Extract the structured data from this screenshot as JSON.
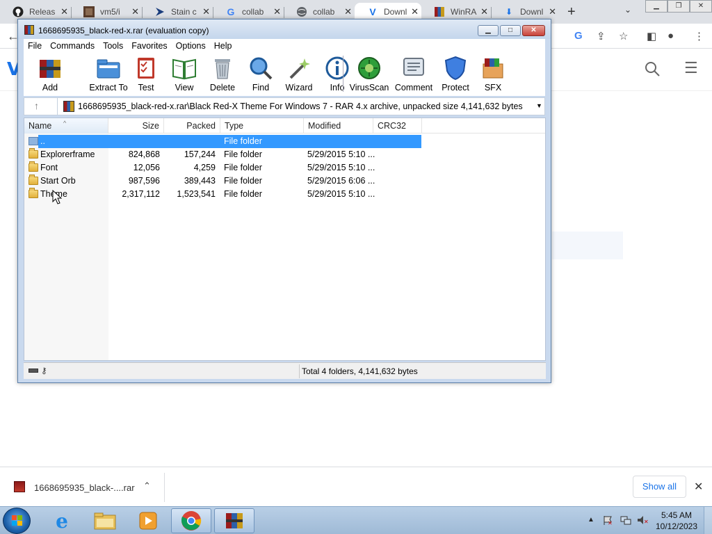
{
  "chrome": {
    "tabs": [
      {
        "title": "Releas",
        "icon": "github-icon"
      },
      {
        "title": "vm5/i",
        "icon": "image-icon"
      },
      {
        "title": "Stain c",
        "icon": "triangle-icon"
      },
      {
        "title": "collab",
        "icon": "google-icon"
      },
      {
        "title": "collab",
        "icon": "globe-icon"
      },
      {
        "title": "Downl",
        "icon": "vk-icon"
      },
      {
        "title": "WinRA",
        "icon": "winrar-icon"
      },
      {
        "title": "Downl",
        "icon": "download-icon"
      }
    ],
    "active_tab_index": 5
  },
  "downloads": {
    "file_name": "1668695935_black-....rar",
    "show_all_label": "Show all"
  },
  "taskbar": {
    "time": "5:45 AM",
    "date": "10/12/2023"
  },
  "winrar": {
    "title": "1668695935_black-red-x.rar (evaluation copy)",
    "menu": [
      "File",
      "Commands",
      "Tools",
      "Favorites",
      "Options",
      "Help"
    ],
    "toolbar": [
      "Add",
      "Extract To",
      "Test",
      "View",
      "Delete",
      "Find",
      "Wizard",
      "Info",
      "VirusScan",
      "Comment",
      "Protect",
      "SFX"
    ],
    "address": "1668695935_black-red-x.rar\\Black Red-X Theme For Windows 7 - RAR 4.x archive, unpacked size 4,141,632 bytes",
    "columns": [
      "Name",
      "Size",
      "Packed",
      "Type",
      "Modified",
      "CRC32"
    ],
    "rows": [
      {
        "name": "..",
        "size": "",
        "packed": "",
        "type": "File folder",
        "modified": "",
        "crc": ""
      },
      {
        "name": "Explorerframe",
        "size": "824,868",
        "packed": "157,244",
        "type": "File folder",
        "modified": "5/29/2015 5:10 ...",
        "crc": ""
      },
      {
        "name": "Font",
        "size": "12,056",
        "packed": "4,259",
        "type": "File folder",
        "modified": "5/29/2015 5:10 ...",
        "crc": ""
      },
      {
        "name": "Start Orb",
        "size": "987,596",
        "packed": "389,443",
        "type": "File folder",
        "modified": "5/29/2015 6:06 ...",
        "crc": ""
      },
      {
        "name": "Theme",
        "size": "2,317,112",
        "packed": "1,523,541",
        "type": "File folder",
        "modified": "5/29/2015 5:10 ...",
        "crc": ""
      }
    ],
    "status": "Total 4 folders, 4,141,632 bytes"
  }
}
